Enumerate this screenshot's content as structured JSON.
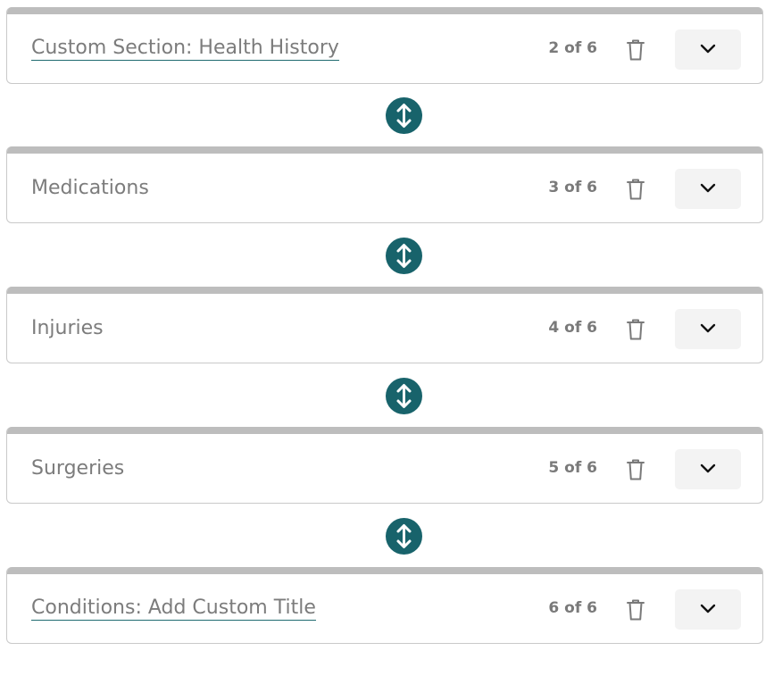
{
  "sections": [
    {
      "title": "Custom Section: Health History",
      "position": "2 of 6",
      "editable_title": true
    },
    {
      "title": "Medications",
      "position": "3 of 6",
      "editable_title": false
    },
    {
      "title": "Injuries",
      "position": "4 of 6",
      "editable_title": false
    },
    {
      "title": "Surgeries",
      "position": "5 of 6",
      "editable_title": false
    },
    {
      "title": "Conditions: Add Custom Title",
      "position": "6 of 6",
      "editable_title": true
    }
  ],
  "icons": {
    "delete": "trash-icon",
    "expand": "chevron-down-icon",
    "reorder": "swap-vertical-icon"
  },
  "colors": {
    "accent": "#18636b",
    "card_top_bar": "#bdbdbd",
    "title_text": "#7c7c7c"
  }
}
